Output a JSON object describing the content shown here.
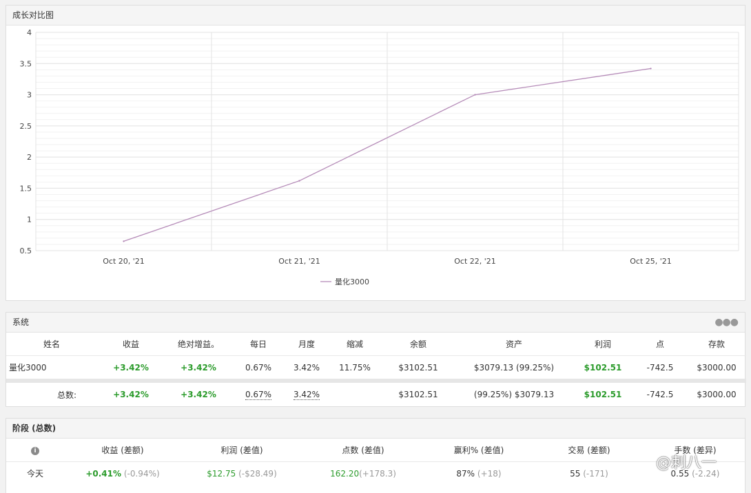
{
  "chart_panel": {
    "title": "成长对比图"
  },
  "chart_data": {
    "type": "line",
    "x": [
      "Oct 20, '21",
      "Oct 21, '21",
      "Oct 22, '21",
      "Oct 25, '21"
    ],
    "ylim": [
      0.5,
      4
    ],
    "yticks": [
      "0.5",
      "1",
      "1.5",
      "2",
      "2.5",
      "3",
      "3.5",
      "4"
    ],
    "series": [
      {
        "name": "量化3000",
        "values": [
          0.65,
          1.62,
          3.0,
          3.42
        ],
        "color": "#b58bb8"
      }
    ],
    "grid": true,
    "legend": "bottom-center"
  },
  "system": {
    "title": "系统",
    "more_icon": "more-horizontal-icon",
    "headers": [
      "姓名",
      "收益",
      "绝对增益。",
      "每日",
      "月度",
      "缩减",
      "余额",
      "资产",
      "利润",
      "点",
      "存款"
    ],
    "row": [
      "量化3000",
      "+3.42%",
      "+3.42%",
      "0.67%",
      "3.42%",
      "11.75%",
      "$3102.51",
      "$3079.13 (99.25%)",
      "$102.51",
      "-742.5",
      "$3000.00"
    ],
    "total": [
      "总数:",
      "+3.42%",
      "+3.42%",
      "0.67%",
      "3.42%",
      "",
      "$3102.51",
      "(99.25%) $3079.13",
      "$102.51",
      "-742.5",
      "$3000.00"
    ]
  },
  "phase": {
    "title": "阶段 (总数)",
    "info_icon": "info-icon",
    "headers": [
      "收益 (差额)",
      "利润 (差值)",
      "点数 (差值)",
      "赢利% (差值)",
      "交易 (差额)",
      "手数 (差异)"
    ],
    "today": {
      "label": "今天",
      "gain": "+0.41%",
      "gain_diff": "(-0.94%)",
      "profit": "$12.75",
      "profit_diff": "(-$28.49)",
      "pips": "162.20",
      "pips_diff": "(+178.3)",
      "won": "87%",
      "won_diff": "(+18)",
      "trades": "55",
      "trades_diff": "(-171)",
      "lots": "0.55",
      "lots_diff": "(-2.24)"
    }
  },
  "watermark": "@刺八一"
}
